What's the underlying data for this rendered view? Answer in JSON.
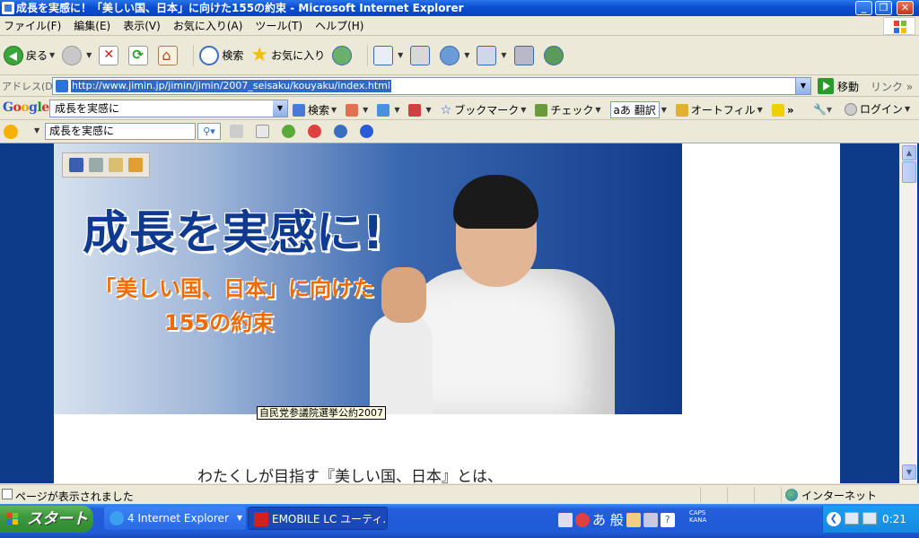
{
  "window": {
    "title": "成長を実感に！「美しい国、日本」に向けた155の約束 - Microsoft Internet Explorer"
  },
  "menu": [
    "ファイル(F)",
    "編集(E)",
    "表示(V)",
    "お気に入り(A)",
    "ツール(T)",
    "ヘルプ(H)"
  ],
  "toolbar": {
    "back": "戻る",
    "search": "検索",
    "favorites": "お気に入り"
  },
  "address": {
    "label": "アドレス(D)",
    "url": "http://www.jimin.jp/jimin/jimin/2007_seisaku/kouyaku/index.html",
    "go": "移動",
    "links": "リンク",
    "links_more": "»"
  },
  "google_toolbar": {
    "logo": "Google",
    "query": "成長を実感に",
    "search": "検索",
    "bookmarks": "ブックマーク",
    "check": "チェック",
    "translate": "翻訳",
    "translate_icon": "aあ",
    "autofill": "オートフィル",
    "more": "»",
    "login": "ログイン"
  },
  "link_toolbar": {
    "query": "成長を実感に"
  },
  "page": {
    "banner_title": "成長を実感に!",
    "banner_sub1": "「美しい国、日本」に向けた",
    "banner_sub2": "155の約束",
    "tooltip": "自民党参議院選挙公約2007",
    "body_text": "わたくしが目指す『美しい国、日本』とは、"
  },
  "status": {
    "text": "ページが表示されました",
    "zone": "インターネット"
  },
  "taskbar": {
    "start": "スタート",
    "tasks": [
      {
        "label": "4 Internet Explorer"
      },
      {
        "label": "EMOBILE LC ユーティ..."
      }
    ],
    "ime_text": "あ 般",
    "caps": "CAPS",
    "kana": "KANA",
    "clock": "0:21"
  },
  "colors": {
    "titlebar": "#0a4fd0",
    "taskbar": "#245edb",
    "page_background": "#0e3a8a",
    "banner_title": "#0f3a8f",
    "banner_sub": "#f06a00"
  }
}
